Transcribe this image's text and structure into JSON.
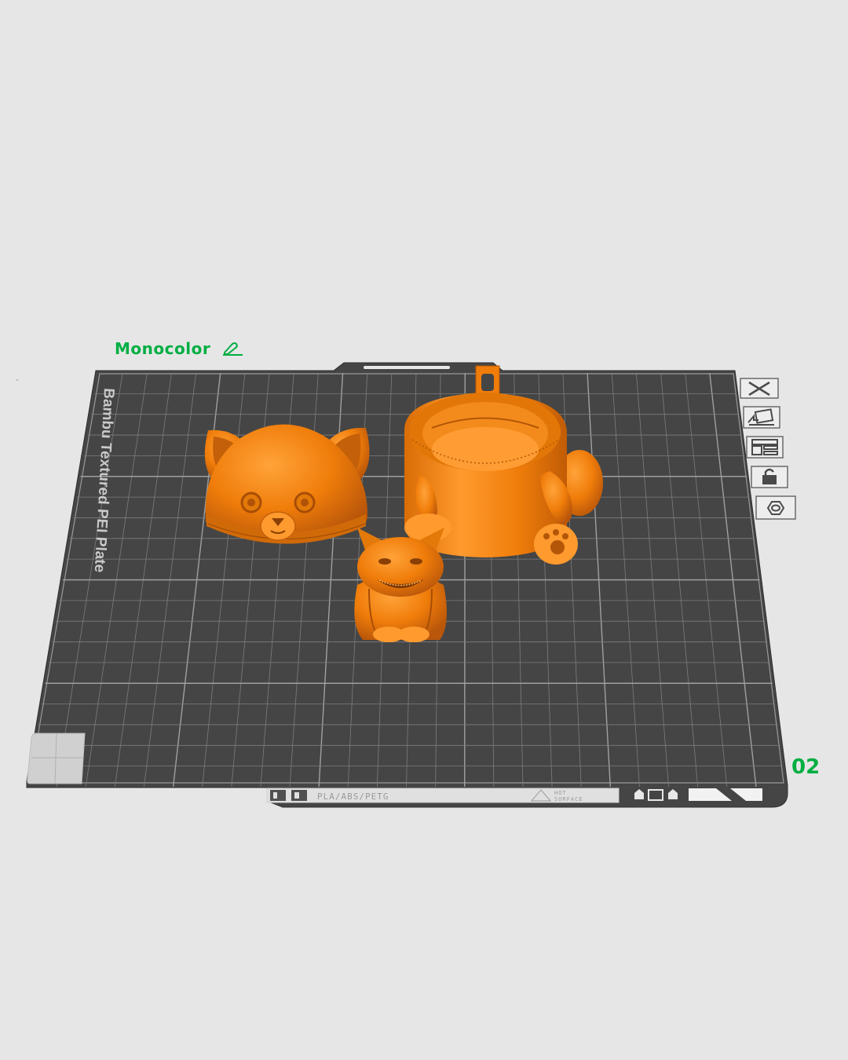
{
  "plate": {
    "mode_label": "Monocolor",
    "number": "02",
    "plate_name": "Bambu Textured PEI Plate",
    "materials": "PLA/ABS/PETG",
    "hot_line1": "HOT",
    "hot_line2": "SURFACE"
  },
  "toolbar": {
    "icons": [
      "close-icon",
      "arrange-icon",
      "layout-icon",
      "lock-icon",
      "settings-icon"
    ]
  },
  "objects": [
    "cat-head-lid",
    "cat-pot-body",
    "grinning-cat-figure"
  ],
  "colors": {
    "background": "#e6e6e6",
    "plate": "#454545",
    "grid": "#8a8a8a",
    "accent": "#00ae42",
    "model": "#f07d0a"
  }
}
